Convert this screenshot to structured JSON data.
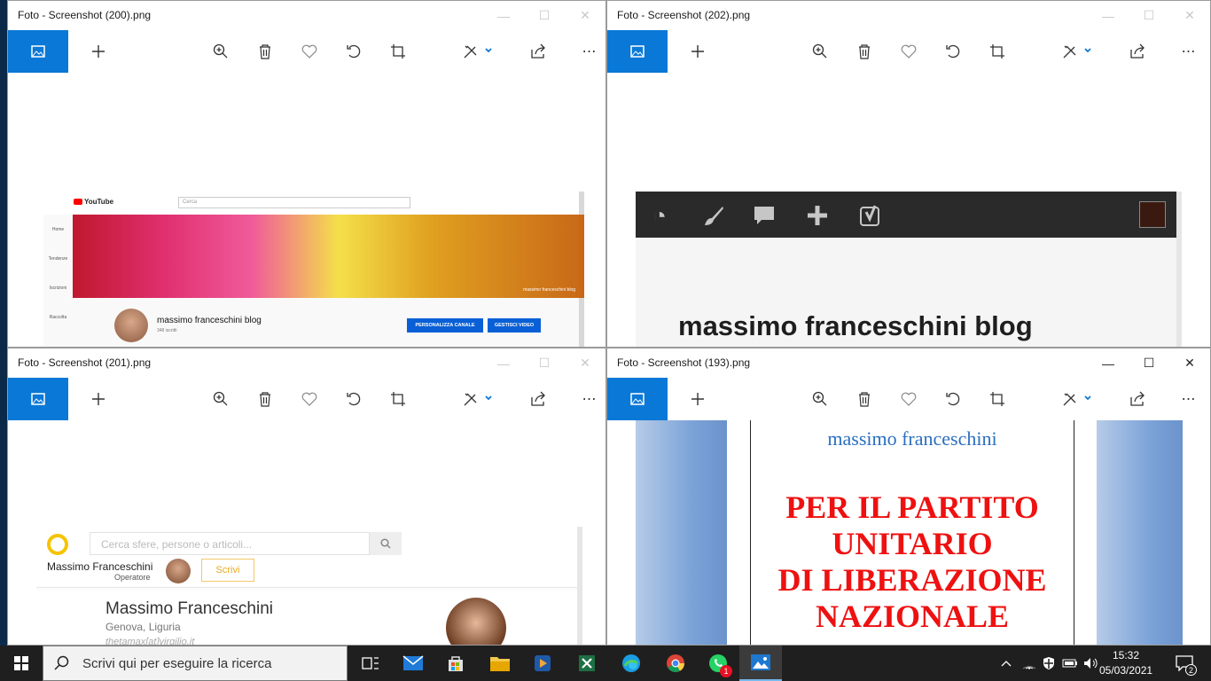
{
  "windows": [
    {
      "title": "Foto - Screenshot (200).png",
      "youtube": {
        "logo": "YouTube",
        "search_placeholder": "Cerca",
        "nav": [
          "Home",
          "Tendenze",
          "Iscrizioni",
          "Raccolta"
        ],
        "banner_label": "massimo franceschini blog",
        "channel_name": "massimo franceschini blog",
        "subscribers": "348 iscritti",
        "btn_customize": "PERSONALIZZA CANALE",
        "btn_manage": "GESTISCI VIDEO"
      }
    },
    {
      "title": "Foto - Screenshot (202).png",
      "wordpress": {
        "site_title": "massimo franceschini blog"
      }
    },
    {
      "title": "Foto - Screenshot (201).png",
      "sfere": {
        "search_placeholder": "Cerca sfere, persone o articoli...",
        "user_name": "Massimo Franceschini",
        "user_role": "Operatore",
        "write_button": "Scrivi",
        "profile_name": "Massimo Franceschini",
        "profile_location": "Genova, Liguria",
        "profile_email": "thetamax[at]virgilio.it"
      }
    },
    {
      "title": "Foto - Screenshot (193).png",
      "document": {
        "author": "massimo franceschini",
        "title_lines": [
          "PER IL PARTITO",
          "UNITARIO",
          "DI LIBERAZIONE",
          "NAZIONALE"
        ]
      }
    }
  ],
  "taskbar": {
    "search_placeholder": "Scrivi qui per eseguire la ricerca",
    "time": "15:32",
    "date": "05/03/2021",
    "whatsapp_badge": "1",
    "notifications": "2"
  },
  "colors": {
    "accent": "#0a78d6",
    "doc_red": "#ee1111",
    "doc_blue": "#2b6fbf"
  }
}
